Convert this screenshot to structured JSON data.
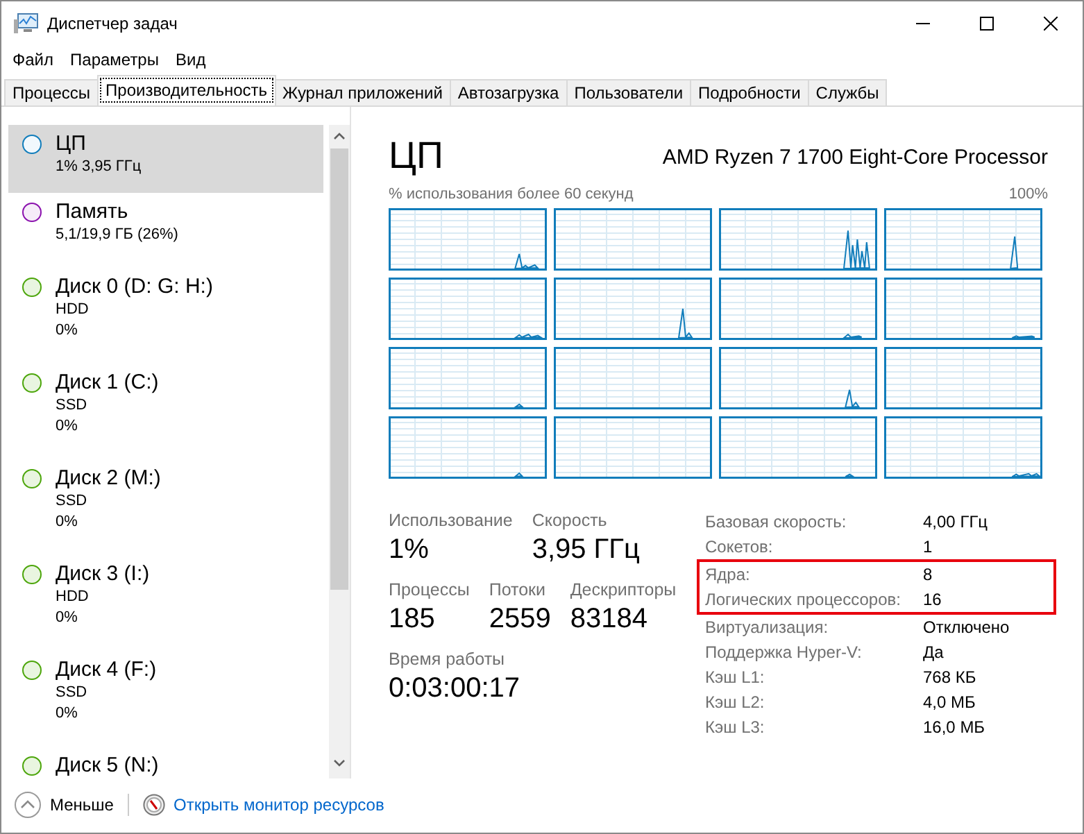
{
  "window": {
    "title": "Диспетчер задач"
  },
  "menu": [
    "Файл",
    "Параметры",
    "Вид"
  ],
  "tabs": [
    {
      "label": "Процессы",
      "selected": false
    },
    {
      "label": "Производительность",
      "selected": true
    },
    {
      "label": "Журнал приложений",
      "selected": false
    },
    {
      "label": "Автозагрузка",
      "selected": false
    },
    {
      "label": "Пользователи",
      "selected": false
    },
    {
      "label": "Подробности",
      "selected": false
    },
    {
      "label": "Службы",
      "selected": false
    }
  ],
  "sidebar": {
    "items": [
      {
        "name": "ЦП",
        "details": [
          "1% 3,95 ГГц"
        ],
        "color": "#117dbb",
        "selected": true
      },
      {
        "name": "Память",
        "details": [
          "5,1/19,9 ГБ (26%)"
        ],
        "color": "#8b12ae",
        "selected": false
      },
      {
        "name": "Диск 0 (D: G: H:)",
        "details": [
          "HDD",
          "0%"
        ],
        "color": "#4da60c",
        "selected": false
      },
      {
        "name": "Диск 1 (C:)",
        "details": [
          "SSD",
          "0%"
        ],
        "color": "#4da60c",
        "selected": false
      },
      {
        "name": "Диск 2 (M:)",
        "details": [
          "SSD",
          "0%"
        ],
        "color": "#4da60c",
        "selected": false
      },
      {
        "name": "Диск 3 (I:)",
        "details": [
          "HDD",
          "0%"
        ],
        "color": "#4da60c",
        "selected": false
      },
      {
        "name": "Диск 4 (F:)",
        "details": [
          "SSD",
          "0%"
        ],
        "color": "#4da60c",
        "selected": false
      },
      {
        "name": "Диск 5 (N:)",
        "color": "#4da60c",
        "selected": false
      }
    ]
  },
  "cpu_panel": {
    "title": "ЦП",
    "processor": "AMD Ryzen 7 1700 Eight-Core Processor",
    "graph_caption": "% использования более 60 секунд",
    "graph_max": "100%",
    "stat_rows": [
      {
        "items": [
          {
            "label": "Использование",
            "value": "1%"
          },
          {
            "label": "Скорость",
            "value": "3,95 ГГц"
          }
        ]
      },
      {
        "items": [
          {
            "label": "Процессы",
            "value": "185"
          },
          {
            "label": "Потоки",
            "value": "2559"
          },
          {
            "label": "Дескрипторы",
            "value": "83184"
          }
        ]
      },
      {
        "items": [
          {
            "label": "Время работы",
            "value": "0:03:00:17"
          }
        ]
      }
    ],
    "details": [
      {
        "label": "Базовая скорость:",
        "value": "4,00 ГГц",
        "highlighted": false
      },
      {
        "label": "Сокетов:",
        "value": "1",
        "highlighted": false
      },
      {
        "label": "Ядра:",
        "value": "8",
        "highlighted": true
      },
      {
        "label": "Логических процессоров:",
        "value": "16",
        "highlighted": true
      },
      {
        "label": "Виртуализация:",
        "value": "Отключено",
        "highlighted": false
      },
      {
        "label": "Поддержка Hyper-V:",
        "value": "Да",
        "highlighted": false
      },
      {
        "label": "Кэш L1:",
        "value": "768 КБ",
        "highlighted": false
      },
      {
        "label": "Кэш L2:",
        "value": "4,0 МБ",
        "highlighted": false
      },
      {
        "label": "Кэш L3:",
        "value": "16,0 МБ",
        "highlighted": false
      }
    ]
  },
  "footer": {
    "fewer": "Меньше",
    "link": "Открыть монитор ресурсов"
  }
}
